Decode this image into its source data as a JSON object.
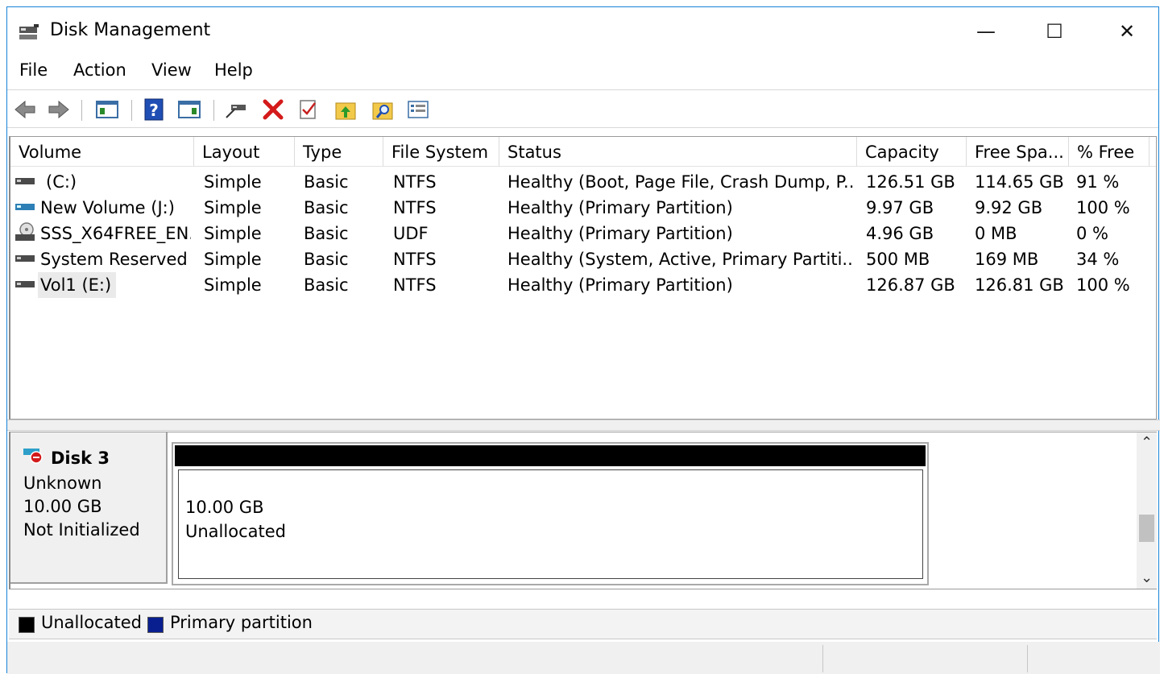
{
  "window": {
    "title": "Disk Management"
  },
  "window_controls": {
    "minimize": "—",
    "maximize": "☐",
    "close": "✕"
  },
  "menu": [
    "File",
    "Action",
    "View",
    "Help"
  ],
  "toolbar_icons": [
    "back-icon",
    "forward-icon",
    "show-hide-console-tree-icon",
    "help-icon",
    "show-hide-action-pane-icon",
    "connect-drive-icon",
    "delete-icon",
    "check-icon",
    "up-folder-icon",
    "search-folder-icon",
    "properties-icon"
  ],
  "volume_table": {
    "columns": [
      "Volume",
      "Layout",
      "Type",
      "File System",
      "Status",
      "Capacity",
      "Free Spa...",
      "% Free"
    ],
    "rows": [
      {
        "icon": "drive-icon",
        "volume": "(C:)",
        "layout": "Simple",
        "type": "Basic",
        "fs": "NTFS",
        "status": "Healthy (Boot, Page File, Crash Dump, P...",
        "capacity": "126.51 GB",
        "free": "114.65 GB",
        "pct": "91 %"
      },
      {
        "icon": "drive-blue-icon",
        "volume": "New Volume (J:)",
        "layout": "Simple",
        "type": "Basic",
        "fs": "NTFS",
        "status": "Healthy (Primary Partition)",
        "capacity": "9.97 GB",
        "free": "9.92 GB",
        "pct": "100 %"
      },
      {
        "icon": "cd-drive-icon",
        "volume": "SSS_X64FREE_EN...",
        "layout": "Simple",
        "type": "Basic",
        "fs": "UDF",
        "status": "Healthy (Primary Partition)",
        "capacity": "4.96 GB",
        "free": "0 MB",
        "pct": "0 %"
      },
      {
        "icon": "drive-icon",
        "volume": "System Reserved",
        "layout": "Simple",
        "type": "Basic",
        "fs": "NTFS",
        "status": "Healthy (System, Active, Primary Partiti...",
        "capacity": "500 MB",
        "free": "169 MB",
        "pct": "34 %"
      },
      {
        "icon": "drive-icon",
        "volume": "Vol1 (E:)",
        "layout": "Simple",
        "type": "Basic",
        "fs": "NTFS",
        "status": "Healthy (Primary Partition)",
        "capacity": "126.87 GB",
        "free": "126.81 GB",
        "pct": "100 %"
      }
    ]
  },
  "disk": {
    "name": "Disk 3",
    "type": "Unknown",
    "size": "10.00 GB",
    "state": "Not Initialized",
    "partition_size": "10.00 GB",
    "partition_label": "Unallocated"
  },
  "scroll": {
    "up": "⌃",
    "down": "⌄"
  },
  "legend": [
    {
      "label": "Unallocated",
      "color": "#000000"
    },
    {
      "label": "Primary partition",
      "color": "#0a1f8f"
    }
  ]
}
